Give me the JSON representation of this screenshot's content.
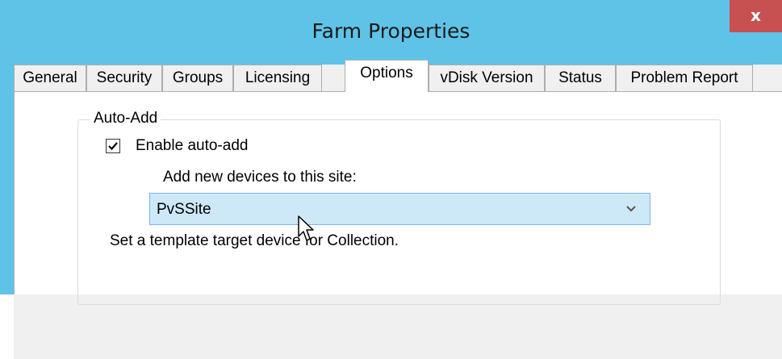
{
  "window": {
    "title": "Farm Properties",
    "close_label": "x"
  },
  "tabs": [
    {
      "label": "General"
    },
    {
      "label": "Security"
    },
    {
      "label": "Groups"
    },
    {
      "label": "Licensing"
    },
    {
      "label": "Options",
      "active": true
    },
    {
      "label": "vDisk Version"
    },
    {
      "label": "Status"
    },
    {
      "label": "Problem Report"
    }
  ],
  "auto_add": {
    "group_label": "Auto-Add",
    "enable_label": "Enable auto-add",
    "enable_checked": true,
    "site_prompt": "Add new devices to this site:",
    "site_value": "PvSSite",
    "template_label": "Set a template target device for Collection."
  },
  "colors": {
    "titlebar": "#5fc3e8",
    "close": "#c75050",
    "dropdown_bg": "#cde8f7"
  },
  "icons": {
    "close": "close-icon",
    "chevron": "chevron-down-icon",
    "cursor": "mouse-pointer-icon"
  }
}
